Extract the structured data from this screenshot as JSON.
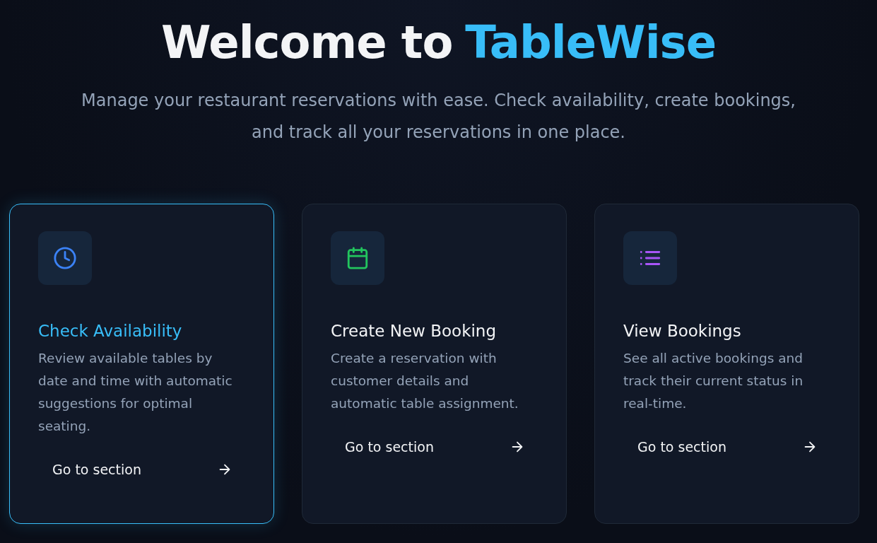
{
  "header": {
    "title_lead": "Welcome to",
    "title_brand": "TableWise",
    "subtitle": "Manage your restaurant reservations with ease. Check availability, create bookings, and track all your reservations in one place."
  },
  "cards": [
    {
      "kind": "clock",
      "color": "#3b82f6",
      "selected": true,
      "title": "Check Availability",
      "description": "Review available tables by date and time with automatic suggestions for optimal seating.",
      "action": "Go to section"
    },
    {
      "kind": "calendar",
      "color": "#22c55e",
      "selected": false,
      "title": "Create New Booking",
      "description": "Create a reservation with customer details and automatic table assignment.",
      "action": "Go to section"
    },
    {
      "kind": "list",
      "color": "#a855f7",
      "selected": false,
      "title": "View Bookings",
      "description": "See all active bookings and track their current status in real-time.",
      "action": "Go to section"
    }
  ]
}
